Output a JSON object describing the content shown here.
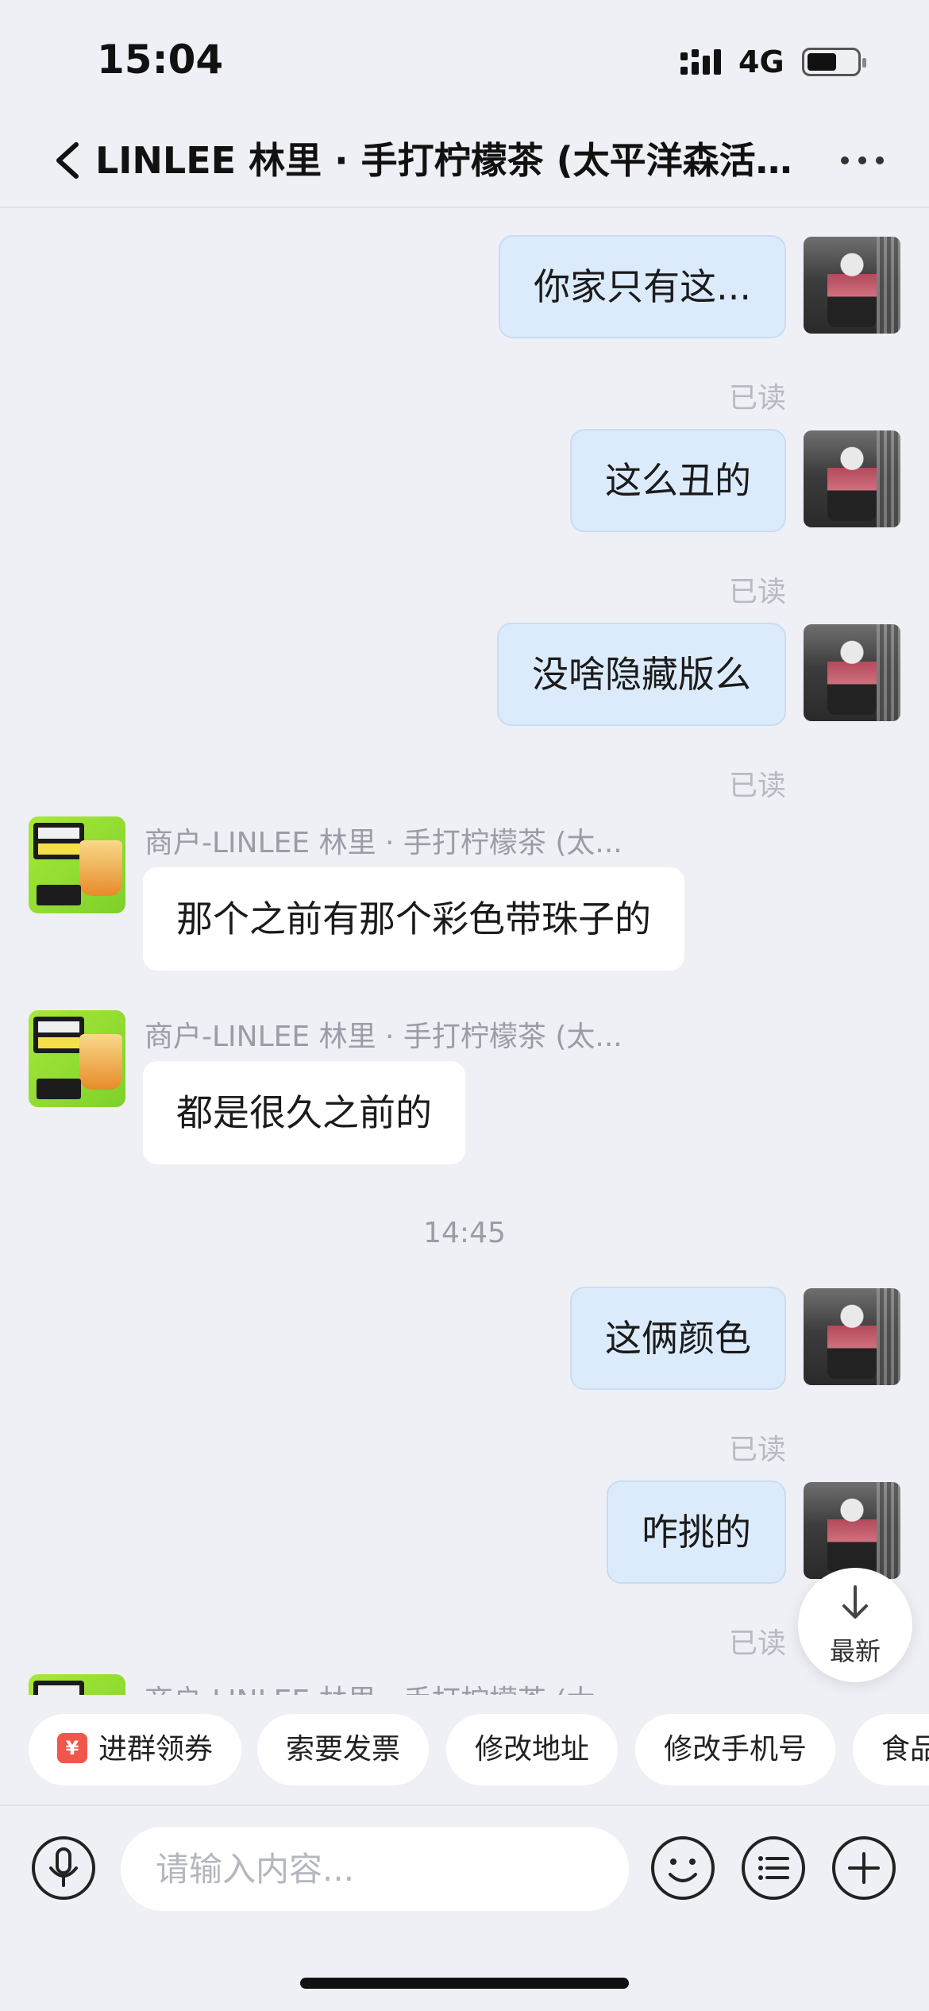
{
  "status_bar": {
    "time": "15:04",
    "network": "4G"
  },
  "header": {
    "title": "LINLEE 林里 · 手打柠檬茶 (太平洋森活..."
  },
  "messages": [
    {
      "type": "out",
      "text": "你家只有这...",
      "status": "已读"
    },
    {
      "type": "out",
      "text": "这么丑的",
      "status": "已读"
    },
    {
      "type": "out",
      "text": "没啥隐藏版么",
      "status": "已读"
    },
    {
      "type": "in",
      "sender": "商户-LINLEE 林里 · 手打柠檬茶 (太...",
      "text": "那个之前有那个彩色带珠子的"
    },
    {
      "type": "in",
      "sender": "商户-LINLEE 林里 · 手打柠檬茶 (太...",
      "text": "都是很久之前的"
    },
    {
      "type": "time",
      "text": "14:45"
    },
    {
      "type": "out",
      "text": "这俩颜色",
      "status": "已读"
    },
    {
      "type": "out",
      "text": "咋挑的",
      "status": "已读"
    },
    {
      "type": "in",
      "sender": "商户-LINLEE 林里 · 手打柠檬茶 (太..."
    }
  ],
  "latest_button": {
    "label": "最新"
  },
  "quick_chips": [
    "进群领券",
    "索要发票",
    "修改地址",
    "修改手机号",
    "食品"
  ],
  "input": {
    "placeholder": "请输入内容..."
  },
  "colors": {
    "background": "#eef0f6",
    "outgoing_bubble": "#dcebfb",
    "incoming_bubble": "#ffffff",
    "read_text": "#b7bac2"
  }
}
